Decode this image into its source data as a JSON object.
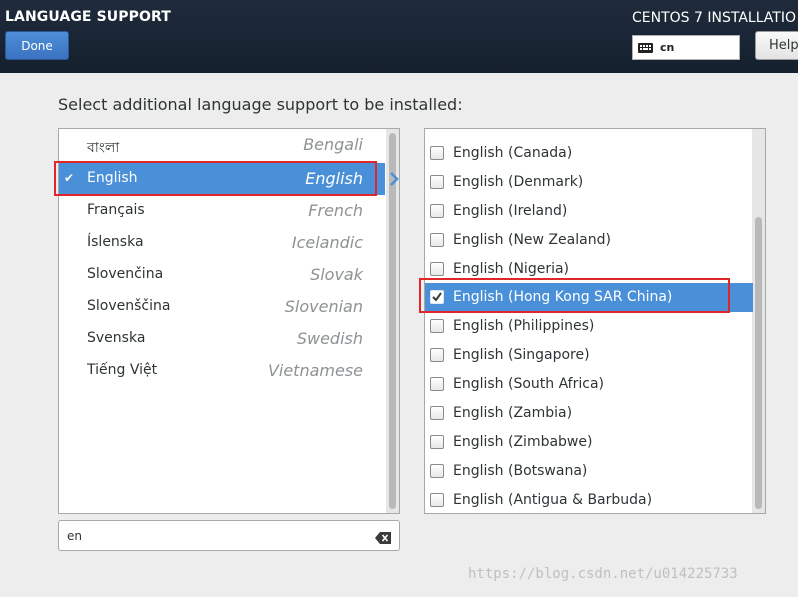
{
  "header": {
    "title": "LANGUAGE SUPPORT",
    "done_label": "Done",
    "product_title": "CENTOS 7 INSTALLATIO",
    "keyboard_layout": "cn",
    "help_label": "Help"
  },
  "prompt": "Select additional language support to be installed:",
  "languages": [
    {
      "native": "বাংলা",
      "english": "Bengali",
      "selected": false
    },
    {
      "native": "English",
      "english": "English",
      "selected": true
    },
    {
      "native": "Français",
      "english": "French",
      "selected": false
    },
    {
      "native": "Íslenska",
      "english": "Icelandic",
      "selected": false
    },
    {
      "native": "Slovenčina",
      "english": "Slovak",
      "selected": false
    },
    {
      "native": "Slovenščina",
      "english": "Slovenian",
      "selected": false
    },
    {
      "native": "Svenska",
      "english": "Swedish",
      "selected": false
    },
    {
      "native": "Tiếng Việt",
      "english": "Vietnamese",
      "selected": false
    }
  ],
  "search": {
    "value": "en"
  },
  "locales": [
    {
      "label": "English (Canada)",
      "checked": false,
      "selected": false
    },
    {
      "label": "English (Denmark)",
      "checked": false,
      "selected": false
    },
    {
      "label": "English (Ireland)",
      "checked": false,
      "selected": false
    },
    {
      "label": "English (New Zealand)",
      "checked": false,
      "selected": false
    },
    {
      "label": "English (Nigeria)",
      "checked": false,
      "selected": false
    },
    {
      "label": "English (Hong Kong SAR China)",
      "checked": true,
      "selected": true
    },
    {
      "label": "English (Philippines)",
      "checked": false,
      "selected": false
    },
    {
      "label": "English (Singapore)",
      "checked": false,
      "selected": false
    },
    {
      "label": "English (South Africa)",
      "checked": false,
      "selected": false
    },
    {
      "label": "English (Zambia)",
      "checked": false,
      "selected": false
    },
    {
      "label": "English (Zimbabwe)",
      "checked": false,
      "selected": false
    },
    {
      "label": "English (Botswana)",
      "checked": false,
      "selected": false
    },
    {
      "label": "English (Antigua & Barbuda)",
      "checked": false,
      "selected": false
    }
  ],
  "watermark": "https://blog.csdn.net/u014225733",
  "colors": {
    "header_bg": "#1f2b3c",
    "selection": "#4a90d9",
    "done_button": "#4e8ed8",
    "annotation_red": "#e0262b"
  }
}
